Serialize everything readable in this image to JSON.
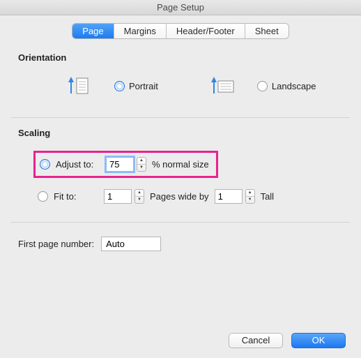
{
  "window": {
    "title": "Page Setup"
  },
  "tabs": [
    {
      "label": "Page",
      "active": true
    },
    {
      "label": "Margins",
      "active": false
    },
    {
      "label": "Header/Footer",
      "active": false
    },
    {
      "label": "Sheet",
      "active": false
    }
  ],
  "sections": {
    "orientation": {
      "title": "Orientation",
      "portrait": "Portrait",
      "landscape": "Landscape",
      "selected": "portrait"
    },
    "scaling": {
      "title": "Scaling",
      "adjust_label": "Adjust to:",
      "adjust_value": "75",
      "adjust_suffix": "% normal size",
      "fit_label": "Fit to:",
      "fit_wide_value": "1",
      "fit_mid_label": "Pages wide by",
      "fit_tall_value": "1",
      "fit_tall_label": "Tall",
      "selected": "adjust"
    },
    "first_page": {
      "label": "First page number:",
      "value": "Auto"
    }
  },
  "buttons": {
    "cancel": "Cancel",
    "ok": "OK"
  }
}
